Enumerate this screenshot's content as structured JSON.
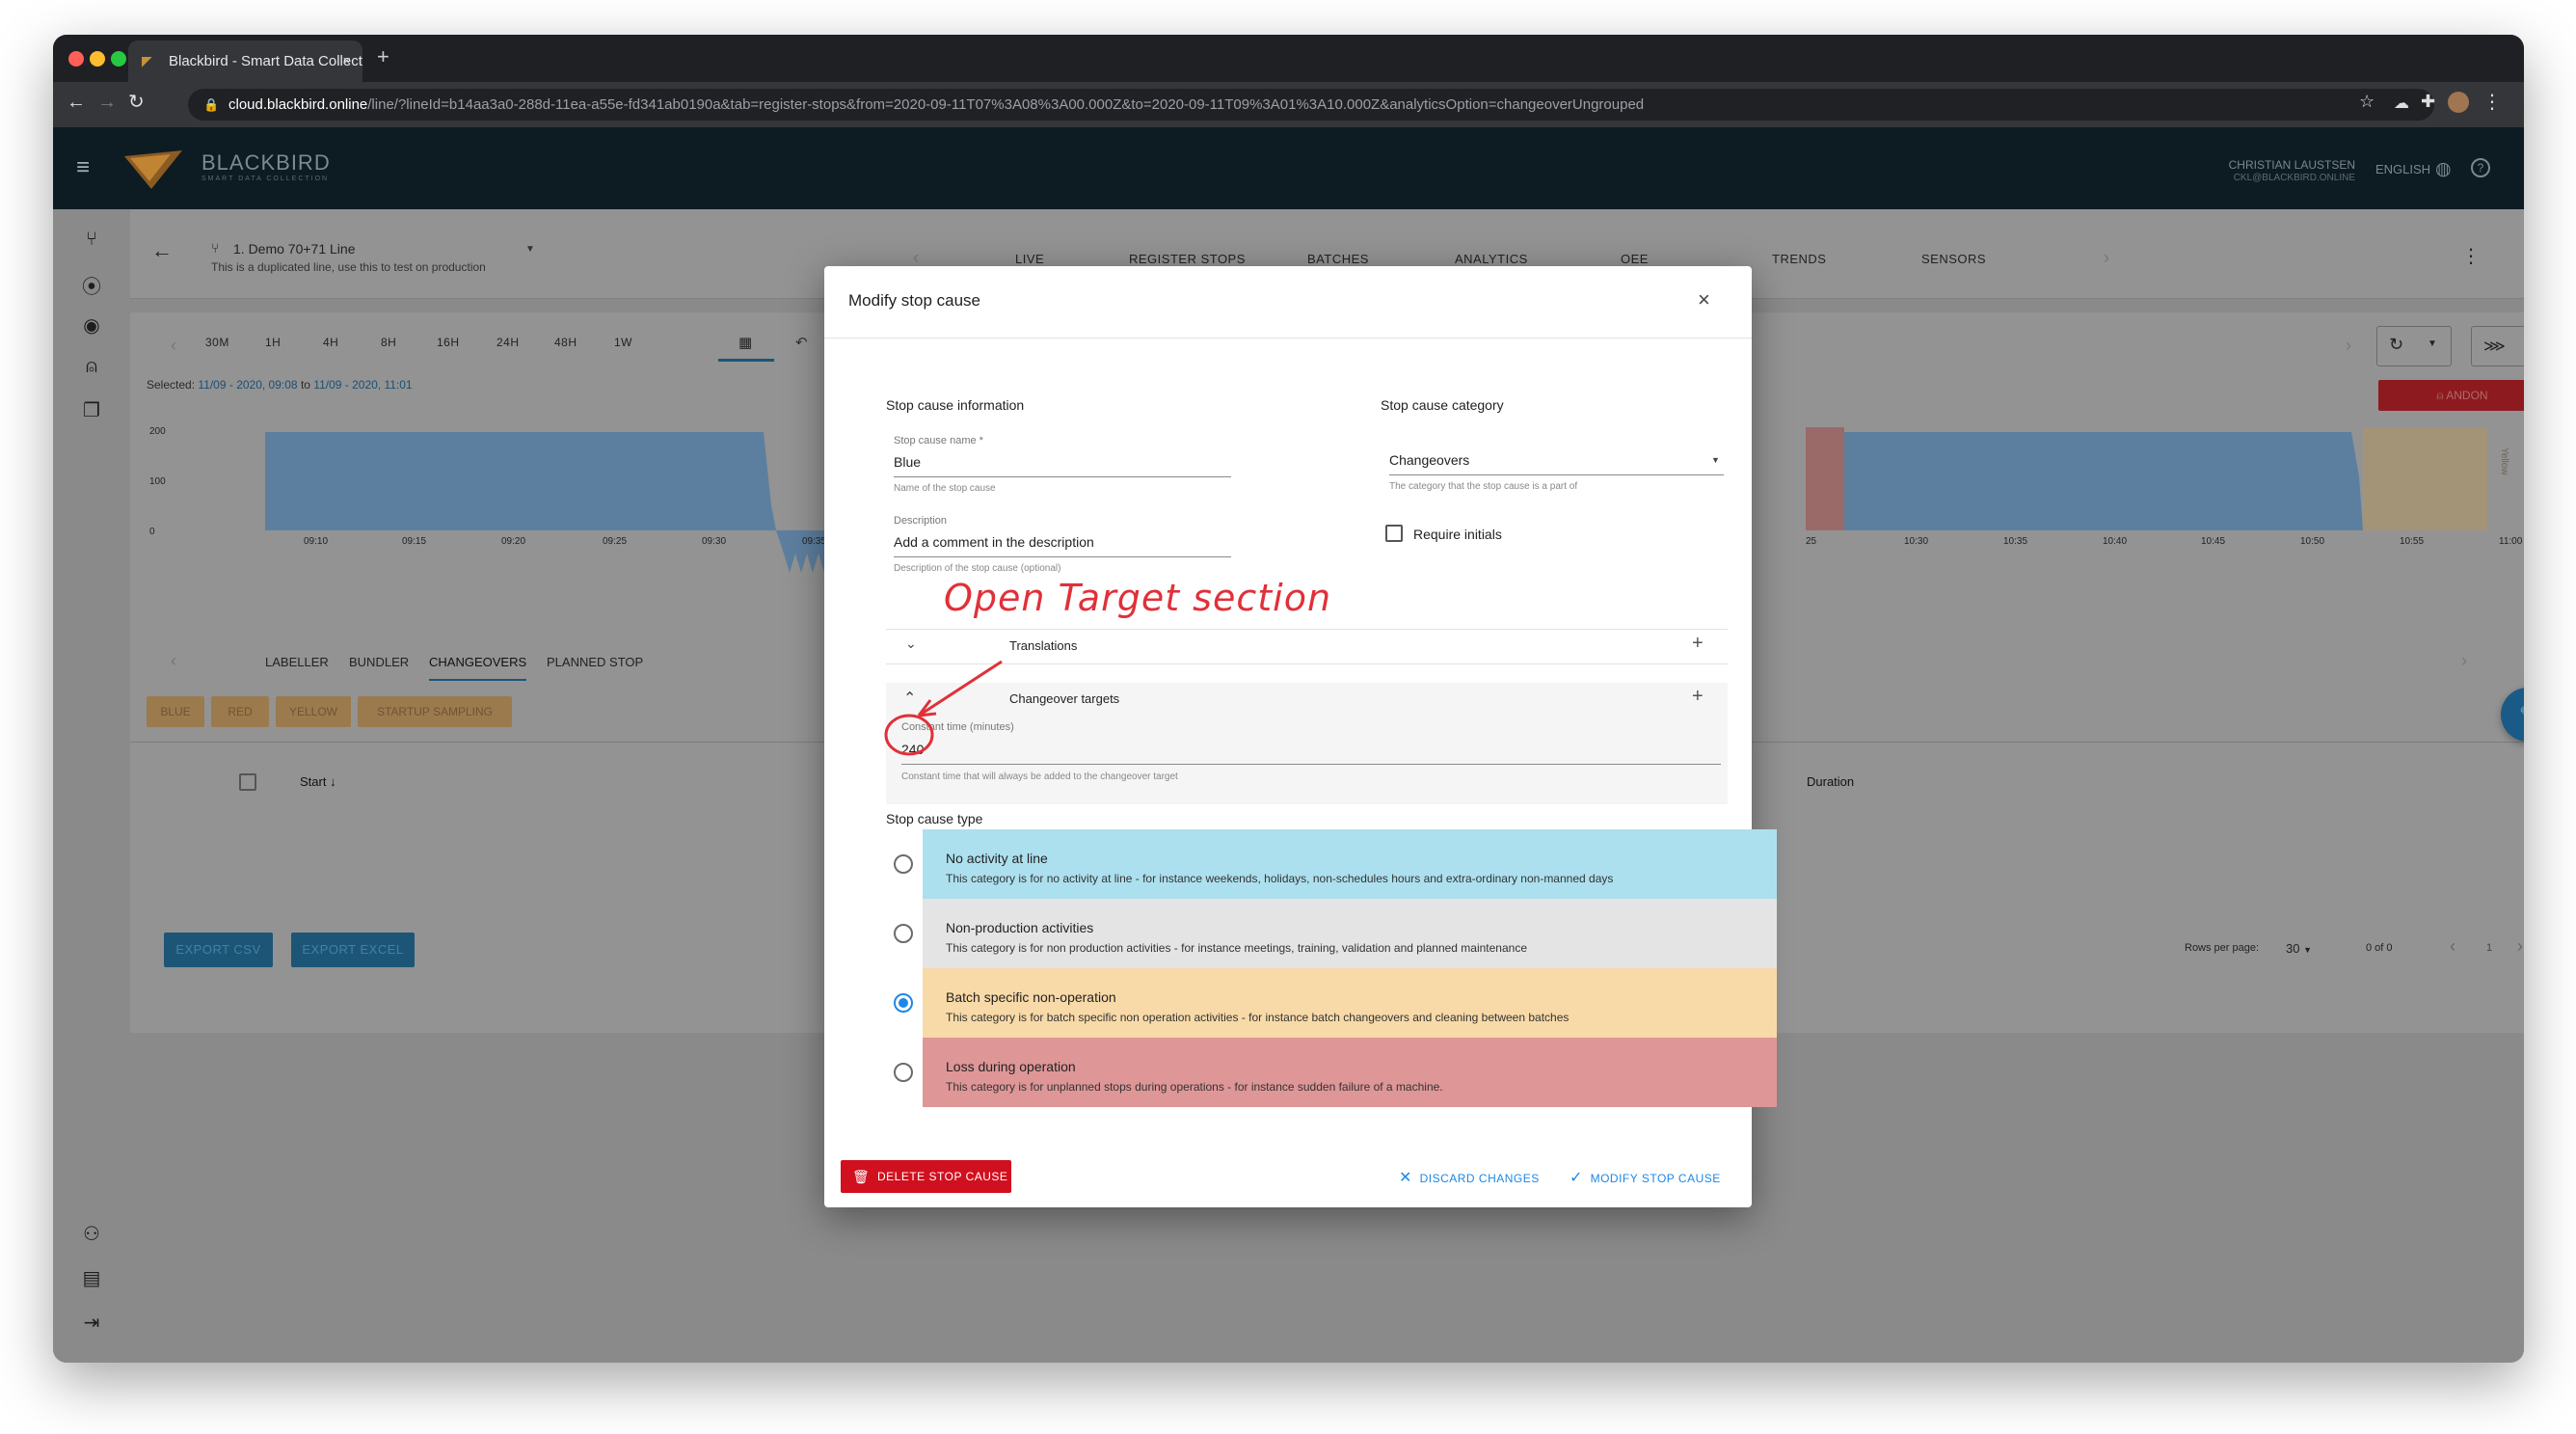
{
  "browser": {
    "tab_title": "Blackbird - Smart Data Collect",
    "tab_close": "×",
    "new_tab": "+",
    "url_host": "cloud.blackbird.online",
    "url_path": "/line/?lineId=b14aa3a0-288d-11ea-a55e-fd341ab0190a&tab=register-stops&from=2020-09-11T07%3A08%3A00.000Z&to=2020-09-11T09%3A01%3A10.000Z&analyticsOption=changeoverUngrouped"
  },
  "appbar": {
    "brand": "BLACKBIRD",
    "tagline": "SMART DATA COLLECTION",
    "user_name": "CHRISTIAN LAUSTSEN",
    "user_email": "CKL@BLACKBIRD.ONLINE",
    "language": "ENGLISH"
  },
  "line_header": {
    "title": "1. Demo 70+71 Line",
    "subtitle": "This is a duplicated line, use this to test on production",
    "tabs": [
      "LIVE",
      "REGISTER STOPS",
      "BATCHES",
      "ANALYTICS",
      "OEE",
      "TRENDS",
      "SENSORS"
    ],
    "active_tab": "REGISTER STOPS"
  },
  "time_range": {
    "buttons": [
      "30M",
      "1H",
      "4H",
      "8H",
      "16H",
      "24H",
      "48H",
      "1W"
    ],
    "selected_prefix": "Selected:",
    "selected_from": "11/09 - 2020, 09:08",
    "selected_to_word": "to",
    "selected_to": "11/09 - 2020, 11:01",
    "andon_label": "ANDON",
    "yellow_label": "Yellow"
  },
  "chart_data": {
    "type": "area",
    "y_ticks": [
      "200",
      "100",
      "0"
    ],
    "x_ticks": [
      "09:10",
      "09:15",
      "09:20",
      "09:25",
      "09:30",
      "09:35",
      "25",
      "10:30",
      "10:35",
      "10:40",
      "10:45",
      "10:50",
      "10:55",
      "11:00"
    ],
    "ylim": [
      0,
      200
    ]
  },
  "stop_tabs": {
    "tabs": [
      "LABELLER",
      "BUNDLER",
      "CHANGEOVERS",
      "PLANNED STOP"
    ],
    "active": "CHANGEOVERS",
    "chips": [
      "BLUE",
      "RED",
      "YELLOW",
      "STARTUP SAMPLING"
    ]
  },
  "table": {
    "col_start": "Start",
    "col_duration": "Duration",
    "export_csv": "EXPORT CSV",
    "export_excel": "EXPORT EXCEL",
    "rows_per_page_label": "Rows per page:",
    "rows_per_page_value": "30",
    "range": "0 of 0",
    "page": "1"
  },
  "modal": {
    "title": "Modify stop cause",
    "close": "×",
    "section_info": "Stop cause information",
    "section_category": "Stop cause category",
    "name_label": "Stop cause name *",
    "name_value": "Blue",
    "name_help": "Name of the stop cause",
    "desc_label": "Description",
    "desc_value": "Add a comment in the description",
    "desc_help": "Description of the stop cause (optional)",
    "category_value": "Changeovers",
    "category_help": "The category that the stop cause is a part of",
    "require_initials": "Require initials",
    "translations": "Translations",
    "changeover_targets": "Changeover targets",
    "constant_label": "Constant time (minutes)",
    "constant_value": "240",
    "constant_help": "Constant time that will always be added to the changeover target",
    "type_heading": "Stop cause type",
    "types": [
      {
        "title": "No activity at line",
        "desc": "This category is for no activity at line - for instance weekends, holidays, non-schedules hours and extra-ordinary non-manned days",
        "color": "#ade0ee"
      },
      {
        "title": "Non-production activities",
        "desc": "This category is for non production activities - for instance meetings, training, validation and planned maintenance",
        "color": "#e4e4e4"
      },
      {
        "title": "Batch specific non-operation",
        "desc": "This category is for batch specific non operation activities - for instance batch changeovers and cleaning between batches",
        "color": "#f8d9a8"
      },
      {
        "title": "Loss during operation",
        "desc": "This category is for unplanned stops during operations - for instance sudden failure of a machine.",
        "color": "#de9696"
      }
    ],
    "selected_type": 2,
    "delete_label": "DELETE STOP CAUSE",
    "discard_label": "DISCARD CHANGES",
    "modify_label": "MODIFY STOP CAUSE",
    "plus": "+"
  },
  "annotation": {
    "text": "Open Target section"
  },
  "colors": {
    "accent": "#1e88e5",
    "danger": "#d1101f",
    "annotation": "#e0313a"
  }
}
